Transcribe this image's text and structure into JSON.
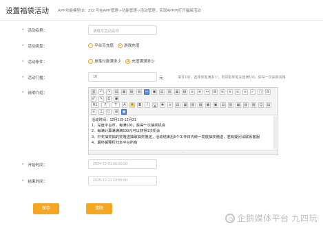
{
  "header": {
    "title": "设置福袋活动",
    "note": "APP功能模型ID：372 可在APP管理->功能管理->活动管理，实现APP内打开福袋活动"
  },
  "form": {
    "name": {
      "label": "活动名称：",
      "placeholder": "请填写活动名称"
    },
    "type": {
      "label": "活动类型：",
      "options": [
        "平台币充值",
        "游戏充值"
      ],
      "selected": 1
    },
    "condition": {
      "label": "活动条件：",
      "options": [
        "单笔付款满多少",
        "充值满满多少"
      ],
      "selected": 1
    },
    "threshold": {
      "label": "活动门槛：",
      "value": "10",
      "unit": "元",
      "hint": "填写100，选择单笔满多少，则领取单笔充值满100，获得一次抽奖资格"
    },
    "description": {
      "label": "说明介绍：",
      "lines": [
        "活动时间：12月1日-12月31",
        "1、充值平台币，每满100，获得一次抽奖机会",
        "2、每满计算满满满100元可以获得1次机会",
        "3、中奖抽奖抽的奖赠送抽取抽奖赠送，活动结束后5个工作日内统一发放抽奖赠送，若有疑问请联系客服",
        "4、最终解释权归本平台所有"
      ],
      "toolbar_row1": [
        "源",
        "↶",
        "↷",
        "▤",
        "▦",
        "▧",
        "▨",
        "✂",
        "▣",
        "▤",
        "▥",
        "▦",
        "▧",
        "≡",
        "≣",
        "↔",
        "⊞",
        "≡",
        "≡",
        "≡",
        "≡",
        "✓",
        "▢",
        "⊟",
        "▣",
        "▤"
      ],
      "toolbar_row2": [
        "x²",
        "✎",
        "⎙",
        "▣"
      ],
      "toolbar_row3": [
        "H1",
        "F",
        "T",
        "A",
        "A",
        "B",
        "I",
        "U",
        "S",
        "≡",
        "▤",
        "▦",
        "▧",
        "▨",
        "▩",
        "▣",
        "▤",
        "▥",
        "▦",
        "▧",
        "▨",
        "☺",
        "▤",
        "▥"
      ],
      "toolbar_row4": [
        "≡",
        "⚓",
        "◫",
        "⊞",
        "◉"
      ]
    },
    "start": {
      "label": "开始时间：",
      "value": "2024-12-01 00:00:00"
    },
    "end": {
      "label": "结束时间：",
      "value": "2025-12-31 23:55:00"
    }
  },
  "buttons": {
    "save": "保存",
    "clear": "清除"
  },
  "watermark": {
    "text": "企鹅媒体平台 九四玩"
  },
  "colors": {
    "accent": "#f5a623",
    "required": "#e74c3c"
  }
}
